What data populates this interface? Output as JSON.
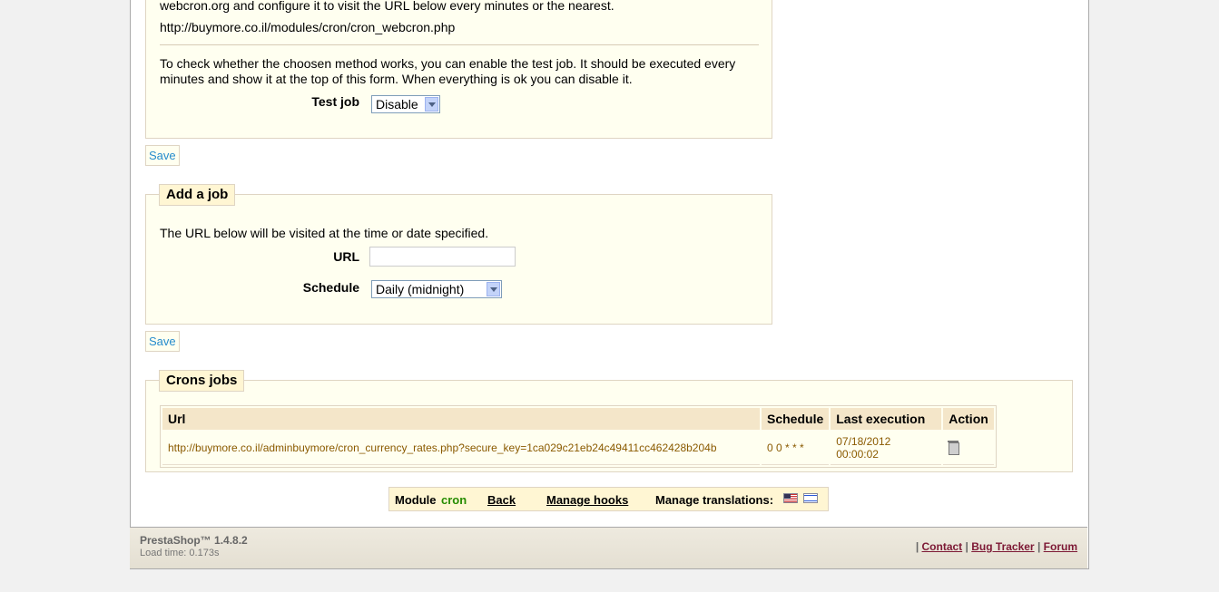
{
  "cron_settings": {
    "intro_line": "webcron.org and configure it to visit the URL below every minutes or the nearest.",
    "webcron_url": "http://buymore.co.il/modules/cron/cron_webcron.php",
    "test_note": "To check whether the choosen method works, you can enable the test job. It should be executed every minutes and show it at the top of this form. When everything is ok you can disable it.",
    "test_job_label": "Test job",
    "test_job_value": "Disable",
    "save_label": "Save"
  },
  "add_job": {
    "legend": "Add a job",
    "description": "The URL below will be visited at the time or date specified.",
    "url_label": "URL",
    "url_value": "",
    "schedule_label": "Schedule",
    "schedule_value": "Daily (midnight)",
    "save_label": "Save"
  },
  "crons_jobs": {
    "legend": "Crons jobs",
    "columns": [
      "Url",
      "Schedule",
      "Last execution",
      "Action"
    ],
    "rows": [
      {
        "url": "http://buymore.co.il/adminbuymore/cron_currency_rates.php?secure_key=1ca029c21eb24c49411cc462428b204b",
        "schedule": "0 0 * * *",
        "last_execution": "07/18/2012 00:00:02",
        "action_icon": "trash-icon"
      }
    ]
  },
  "toolbar": {
    "module_label": "Module",
    "module_name": "cron",
    "back_label": "Back",
    "manage_hooks_label": "Manage hooks",
    "manage_translations_label": "Manage translations:",
    "flags": [
      "us-flag-icon",
      "il-flag-icon"
    ],
    "module_name_color": "#268c00"
  },
  "footer": {
    "version": "PrestaShop™ 1.4.8.2",
    "load_time": "Load time: 0.173s",
    "separator": "|",
    "links": [
      "Contact",
      "Bug Tracker",
      "Forum"
    ]
  }
}
